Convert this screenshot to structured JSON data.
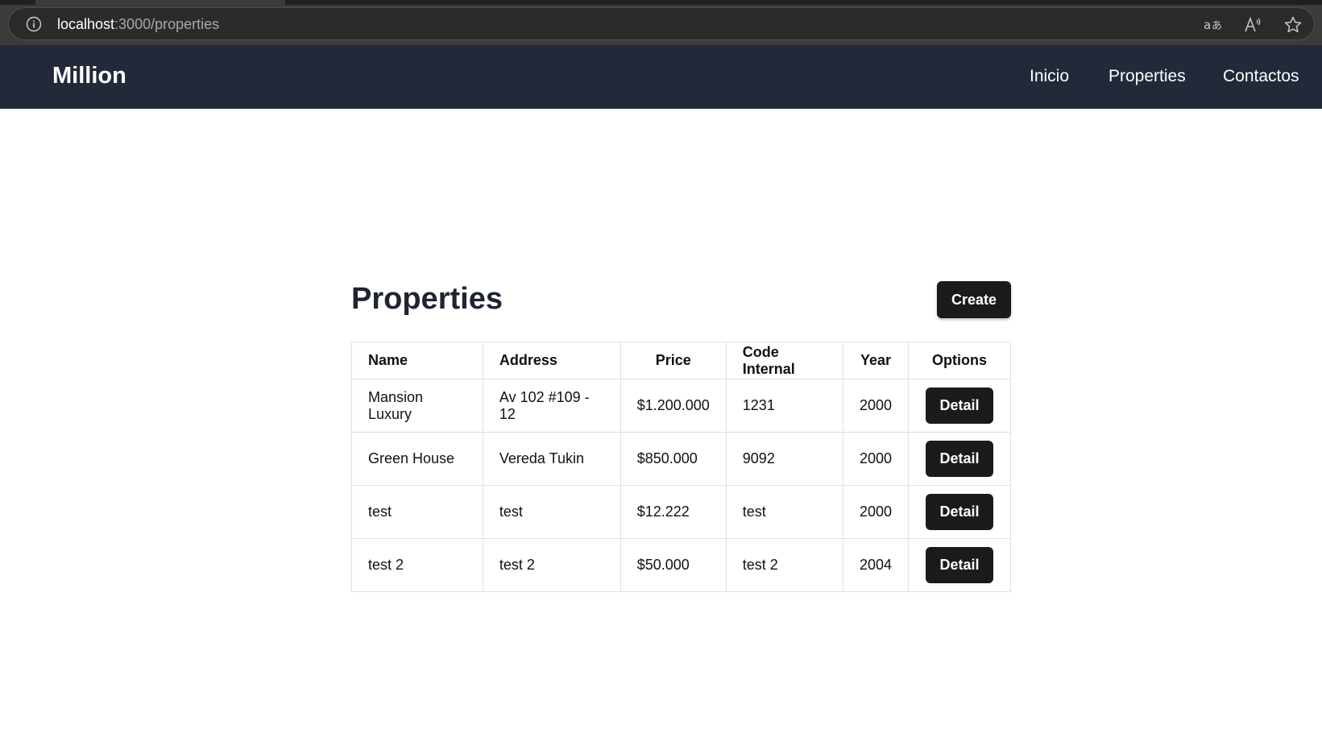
{
  "browser": {
    "url_host": "localhost",
    "url_path": ":3000/properties"
  },
  "navbar": {
    "brand": "Million",
    "links": [
      "Inicio",
      "Properties",
      "Contactos"
    ]
  },
  "main": {
    "title": "Properties",
    "create_label": "Create",
    "table": {
      "headers": [
        "Name",
        "Address",
        "Price",
        "Code Internal",
        "Year",
        "Options"
      ],
      "rows": [
        {
          "name": "Mansion Luxury",
          "address": "Av 102 #109 - 12",
          "price": "$1.200.000",
          "code": "1231",
          "year": "2000",
          "action": "Detail"
        },
        {
          "name": "Green House",
          "address": "Vereda Tukin",
          "price": "$850.000",
          "code": "9092",
          "year": "2000",
          "action": "Detail"
        },
        {
          "name": "test",
          "address": "test",
          "price": "$12.222",
          "code": "test",
          "year": "2000",
          "action": "Detail"
        },
        {
          "name": "test 2",
          "address": "test 2",
          "price": "$50.000",
          "code": "test 2",
          "year": "2004",
          "action": "Detail"
        }
      ]
    }
  },
  "colors": {
    "navbar_bg": "#222a3a",
    "button_bg": "#1b1b1b",
    "title_color": "#1f2433"
  },
  "icons": {
    "info": "info-icon",
    "translate": "translate-icon",
    "read_aloud": "read-aloud-icon",
    "favorite": "star-icon"
  }
}
